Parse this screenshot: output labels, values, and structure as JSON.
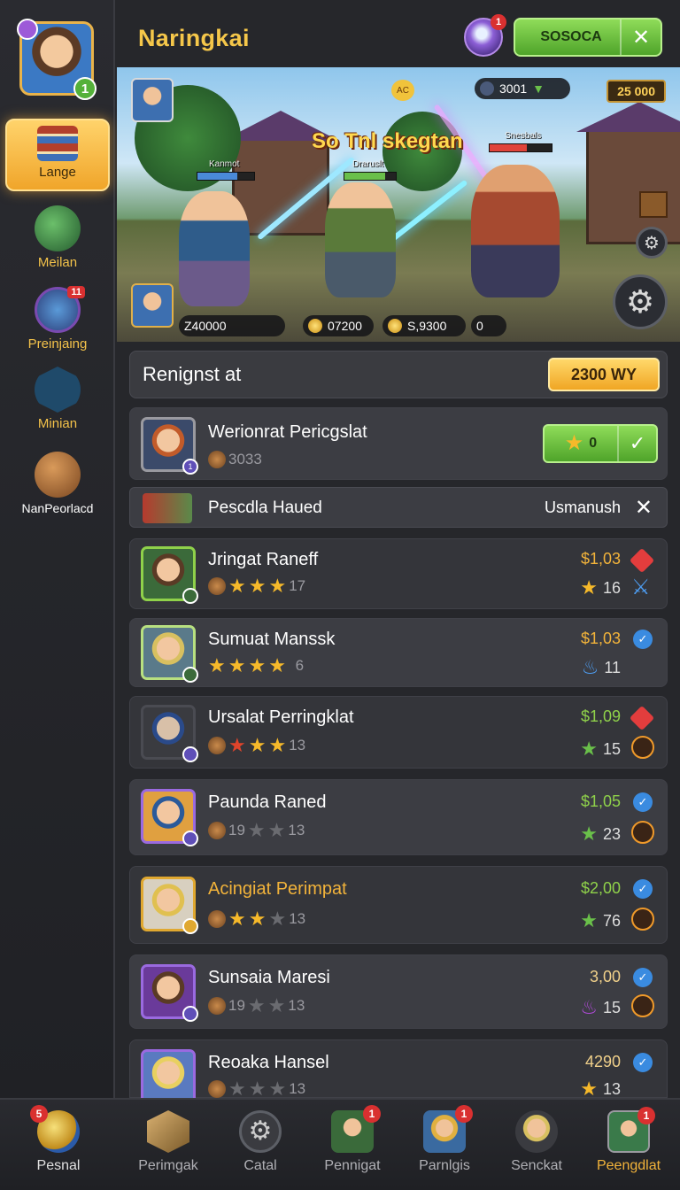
{
  "header": {
    "title": "Naringkai",
    "orb_badge": "1",
    "top_button_label": "SOSOCA"
  },
  "sidebar": {
    "avatar_level": "1",
    "items": [
      {
        "label": "Lange"
      },
      {
        "label": "Meilan"
      },
      {
        "label": "Preinjaing",
        "badge": "11"
      },
      {
        "label": "Minian"
      },
      {
        "label": "NanPeorlacd"
      }
    ]
  },
  "scene": {
    "title": "So Tnl skegtan",
    "coin_top": "AC",
    "player_top": "3001",
    "gold": "25 000",
    "hp_left_name": "Kanmot",
    "hp_mid_name": "Draruslt",
    "hp_right_name": "Snesbals",
    "chip_1": "Z40000",
    "chip_2": "07200",
    "chip_3": "S,9300",
    "chip_4": "0"
  },
  "section": {
    "heading": "Renignst at",
    "button": "2300 WY"
  },
  "featured": {
    "name": "Werionrat Pericgslat",
    "sub": "3033",
    "pill_value": "0"
  },
  "filter": {
    "label": "Pescdla Haued",
    "right": "Usmanush"
  },
  "rows": [
    {
      "name": "Jringat Raneff",
      "sub": "17",
      "price": "$1,03",
      "stat": "16"
    },
    {
      "name": "Sumuat Manssk",
      "sub": "6",
      "price": "$1,03",
      "stat": "11"
    },
    {
      "name": "Ursalat Perringklat",
      "sub": "13",
      "price": "$1,09",
      "stat": "15"
    },
    {
      "name": "Paunda Raned",
      "sub_a": "19",
      "sub": "13",
      "price": "$1,05",
      "stat": "23"
    },
    {
      "name": "Acingiat Perimpat",
      "sub": "13",
      "price": "$2,00",
      "stat": "76"
    },
    {
      "name": "Sunsaia Maresi",
      "sub_a": "19",
      "sub": "13",
      "price": "3,00",
      "stat": "15"
    },
    {
      "name": "Reoaka Hansel",
      "sub": "13",
      "price": "4290",
      "stat": "13"
    }
  ],
  "nav": [
    {
      "label": "Pesnal",
      "badge": "5"
    },
    {
      "label": "Perimgak"
    },
    {
      "label": "Catal"
    },
    {
      "label": "Pennigat",
      "badge": "1"
    },
    {
      "label": "Parnlgis",
      "badge": "1"
    },
    {
      "label": "Senckat"
    },
    {
      "label": "Peengdlat",
      "badge": "1"
    }
  ],
  "colors": {
    "accent_gold": "#f5c74a",
    "accent_green": "#8fd14a",
    "panel": "#34353a"
  }
}
